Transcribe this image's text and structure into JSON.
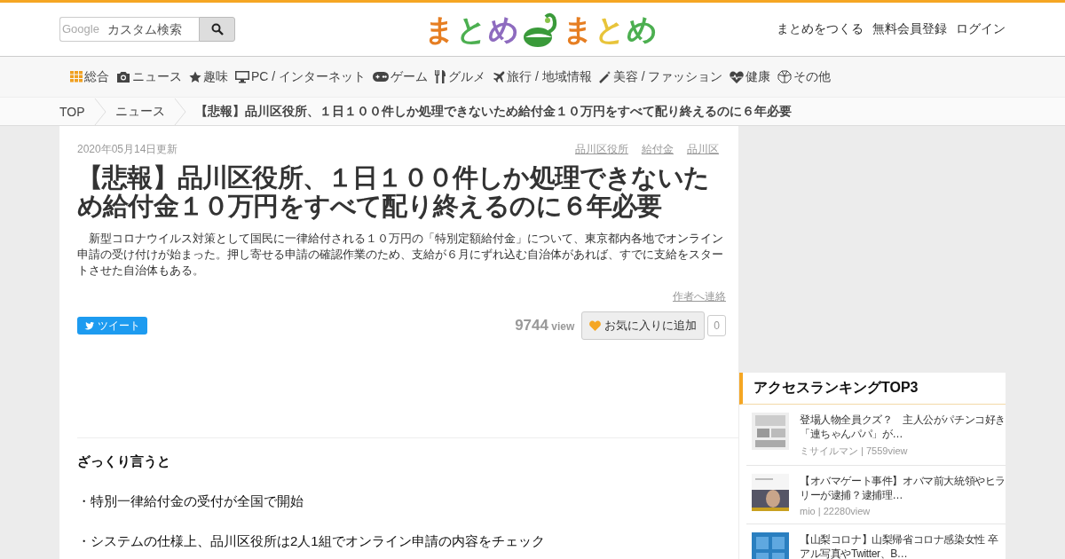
{
  "search": {
    "brand": "Google",
    "placeholder": "カスタム検索"
  },
  "logo": {
    "left": "まとめ",
    "right": "まとめ"
  },
  "header_links": [
    "まとめをつくる",
    "無料会員登録",
    "ログイン"
  ],
  "nav": [
    {
      "label": "総合"
    },
    {
      "label": "ニュース"
    },
    {
      "label": "趣味"
    },
    {
      "label": "PC / インターネット"
    },
    {
      "label": "ゲーム"
    },
    {
      "label": "グルメ"
    },
    {
      "label": "旅行 / 地域情報"
    },
    {
      "label": "美容 / ファッション"
    },
    {
      "label": "健康"
    },
    {
      "label": "その他"
    }
  ],
  "breadcrumb": [
    "TOP",
    "ニュース",
    "【悲報】品川区役所、１日１００件しか処理できないため給付金１０万円をすべて配り終えるのに６年必要"
  ],
  "article": {
    "updated": "2020年05月14日更新",
    "tags": [
      "品川区役所",
      "給付金",
      "品川区"
    ],
    "title": "【悲報】品川区役所、１日１００件しか処理できないため給付金１０万円をすべて配り終えるのに６年必要",
    "lead": "新型コロナウイルス対策として国民に一律給付される１０万円の「特別定額給付金」について、東京都内各地でオンライン申請の受け付けが始まった。押し寄せる申請の確認作業のため、支給が６月にずれ込む自治体があれば、すでに支給をスタートさせた自治体もある。",
    "contact": "作者へ連絡",
    "tweet": "ツイート",
    "views": "9744",
    "views_unit": "view",
    "favorite": "お気に入りに追加",
    "favorite_count": "0",
    "summary_heading": "ざっくり言うと",
    "points": [
      "・特別一律給付金の受付が全国で開始",
      "・システムの仕様上、品川区役所は2人1組でオンライン申請の内容をチェック"
    ]
  },
  "ranking": {
    "title": "アクセスランキングTOP3",
    "items": [
      {
        "title": "登場人物全員クズ？　主人公がパチンコ好き「連ちゃんパパ」が…",
        "meta": "ミサイルマン | 7559view"
      },
      {
        "title": "【オバマゲート事件】オバマ前大統領やヒラリーが逮捕？逮捕理…",
        "meta": "mio | 22280view"
      },
      {
        "title": "【山梨コロナ】山梨帰省コロナ感染女性 卒アル写真やTwitter、B…"
      }
    ]
  }
}
